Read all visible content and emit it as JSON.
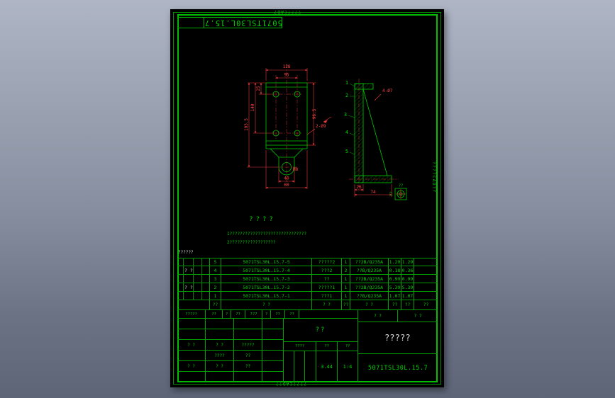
{
  "colors": {
    "line_green": "#00c800",
    "text_green": "#00d000",
    "dim_red": "#e83a3a",
    "table_white": "#d8d8d8",
    "sheet_bg": "#000000"
  },
  "watermarks": {
    "top": "????CAD?",
    "bottom": "????CAD??",
    "right": "????CAD??"
  },
  "stamp": {
    "code": "5071TSL30L.15.7"
  },
  "notes": {
    "title": "????",
    "lines": [
      "1??????????????????????????????",
      "2??????????????????"
    ]
  },
  "drawing": {
    "front": {
      "dim_top_outer": "128",
      "dim_top_inner": "95",
      "dim_left_inner": "25",
      "dim_left_mid": "140",
      "dim_left_outer": "103.5",
      "dim_right": "96.5",
      "hole_callout": "2-Ø9",
      "thread_label": "M8",
      "dim_bottom_inner": "40",
      "dim_bottom_outer": "60"
    },
    "side": {
      "balloons": [
        "1",
        "2",
        "3",
        "4",
        "5"
      ],
      "hole_callout": "4-Ø7",
      "dim_bottom_inner": "26",
      "dim_bottom_outer": "74",
      "detail_top_label": "??",
      "detail_side_label": "??"
    }
  },
  "bom": {
    "corner_note": "??????",
    "header": {
      "no": "??",
      "code": "? ?",
      "name": "? ?",
      "qty": "??",
      "material": "? ?",
      "unit": "??",
      "total": "??",
      "remark": "??"
    },
    "rows": [
      {
        "no": "5",
        "aux": "",
        "code": "5071TSL30L.15.7-5",
        "name": "?????2",
        "qty": "1",
        "material": "??2B/Q235A",
        "unit": "1.29",
        "total": "1.29",
        "remark": ""
      },
      {
        "no": "4",
        "aux": "? ?",
        "code": "5071TSL30L.15.7-4",
        "name": "???2",
        "qty": "2",
        "material": "??B/Q235A",
        "unit": "0.18",
        "total": "0.36",
        "remark": ""
      },
      {
        "no": "3",
        "aux": "",
        "code": "5071TSL30L.15.7-3",
        "name": "??",
        "qty": "1",
        "material": "??2B/Q235A",
        "unit": "0.99",
        "total": "0.99",
        "remark": ""
      },
      {
        "no": "2",
        "aux": "? ?",
        "code": "5071TSL30L.15.7-2",
        "name": "?????1",
        "qty": "1",
        "material": "??2B/Q235A",
        "unit": "5.39",
        "total": "5.39",
        "remark": ""
      },
      {
        "no": "1",
        "aux": "",
        "code": "5071TSL30L.15.7-1",
        "name": "???1",
        "qty": "1",
        "material": "??B/Q235A",
        "unit": "1.07",
        "total": "1.07",
        "remark": ""
      }
    ]
  },
  "revision": {
    "side_label": "?????",
    "cells": [
      "??",
      "?",
      "??",
      "???",
      "?",
      "??",
      "??"
    ]
  },
  "title_block": {
    "sign_rows": [
      {
        "left": "",
        "a": "",
        "b": ""
      },
      {
        "left": "",
        "a": "",
        "b": ""
      },
      {
        "left": "? ?",
        "a": "? ?",
        "b": "?????"
      },
      {
        "left": "",
        "a": "????",
        "b": "??"
      },
      {
        "left": "? ?",
        "a": "? ?",
        "b": "??"
      },
      {
        "left": "",
        "a": "",
        "b": ""
      }
    ],
    "material_mark": "??",
    "stage_label": "????",
    "weight_label": "??",
    "scale_label": "??",
    "weight_value": "3.44",
    "scale_value": "1:4",
    "sheet_info_left": "? ?",
    "sheet_info_right": "? ?",
    "product_name": "?????",
    "drawing_number": "5071TSL30L.15.7"
  }
}
